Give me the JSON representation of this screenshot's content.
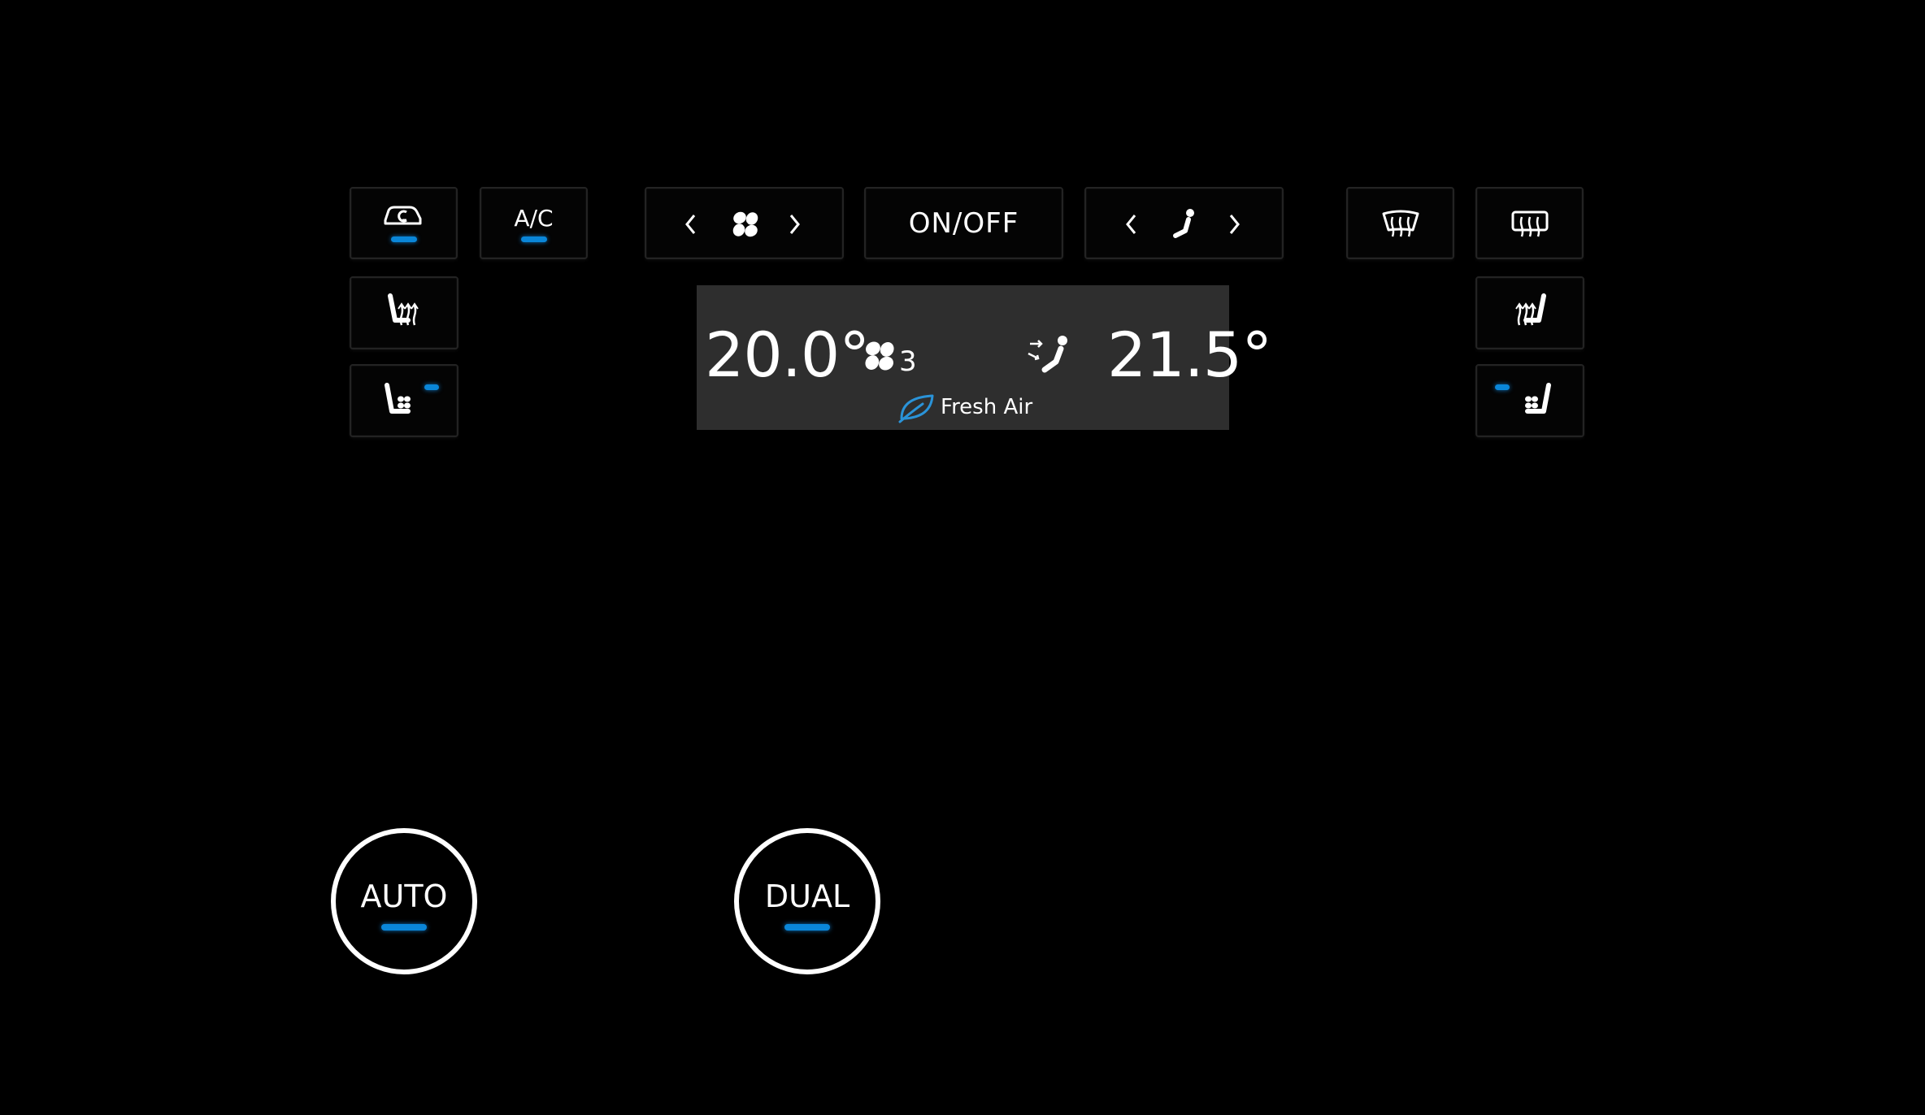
{
  "top_controls": {
    "ac_label": "A/C",
    "onoff_label": "ON/OFF"
  },
  "display": {
    "driver_temp": "20.0°",
    "passenger_temp": "21.5°",
    "fan_level": "3",
    "air_source": "Fresh Air"
  },
  "round_buttons": {
    "auto_label": "AUTO",
    "dual_label": "DUAL"
  },
  "icons": [
    "recirculation-icon",
    "fan-icon",
    "chevron-left-icon",
    "chevron-right-icon",
    "seat-airflow-icon",
    "front-defrost-icon",
    "rear-defrost-icon",
    "heated-seat-icon",
    "cooled-seat-icon",
    "leaf-icon"
  ],
  "colors": {
    "background": "#000000",
    "indicator": "#0a86d8",
    "display_bg": "#2e2e2e",
    "leaf": "#2a93d8"
  },
  "indicators": {
    "recirculation_on": true,
    "ac_on": true,
    "driver_seat_cool_on": true,
    "passenger_seat_cool_on": true,
    "auto_on": true,
    "dual_on": true
  }
}
